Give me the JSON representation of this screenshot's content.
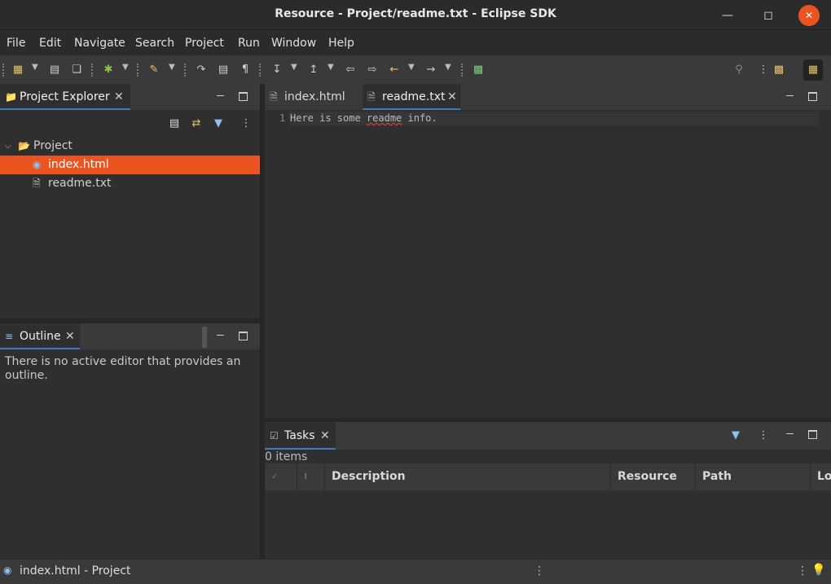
{
  "window": {
    "title": "Resource - Project/readme.txt - Eclipse SDK"
  },
  "menubar": {
    "items": [
      "File",
      "Edit",
      "Navigate",
      "Search",
      "Project",
      "Run",
      "Window",
      "Help"
    ]
  },
  "project_explorer": {
    "tab_label": "Project Explorer",
    "tree": {
      "project": "Project",
      "files": [
        "index.html",
        "readme.txt"
      ],
      "selected": "index.html"
    }
  },
  "outline": {
    "tab_label": "Outline",
    "message": "There is no active editor that provides an outline."
  },
  "editor": {
    "tabs": [
      "index.html",
      "readme.txt"
    ],
    "active_tab": "readme.txt",
    "lines": [
      {
        "number": "1",
        "text_before": "Here is some ",
        "underlined": "readme",
        "text_after": " info."
      }
    ]
  },
  "tasks": {
    "tab_label": "Tasks",
    "count_text": "0 items",
    "columns": [
      "Description",
      "Resource",
      "Path",
      "Lo"
    ]
  },
  "statusbar": {
    "text": "index.html - Project"
  },
  "colors": {
    "selection": "#e95420",
    "accent_blue": "#3d7ab8"
  }
}
